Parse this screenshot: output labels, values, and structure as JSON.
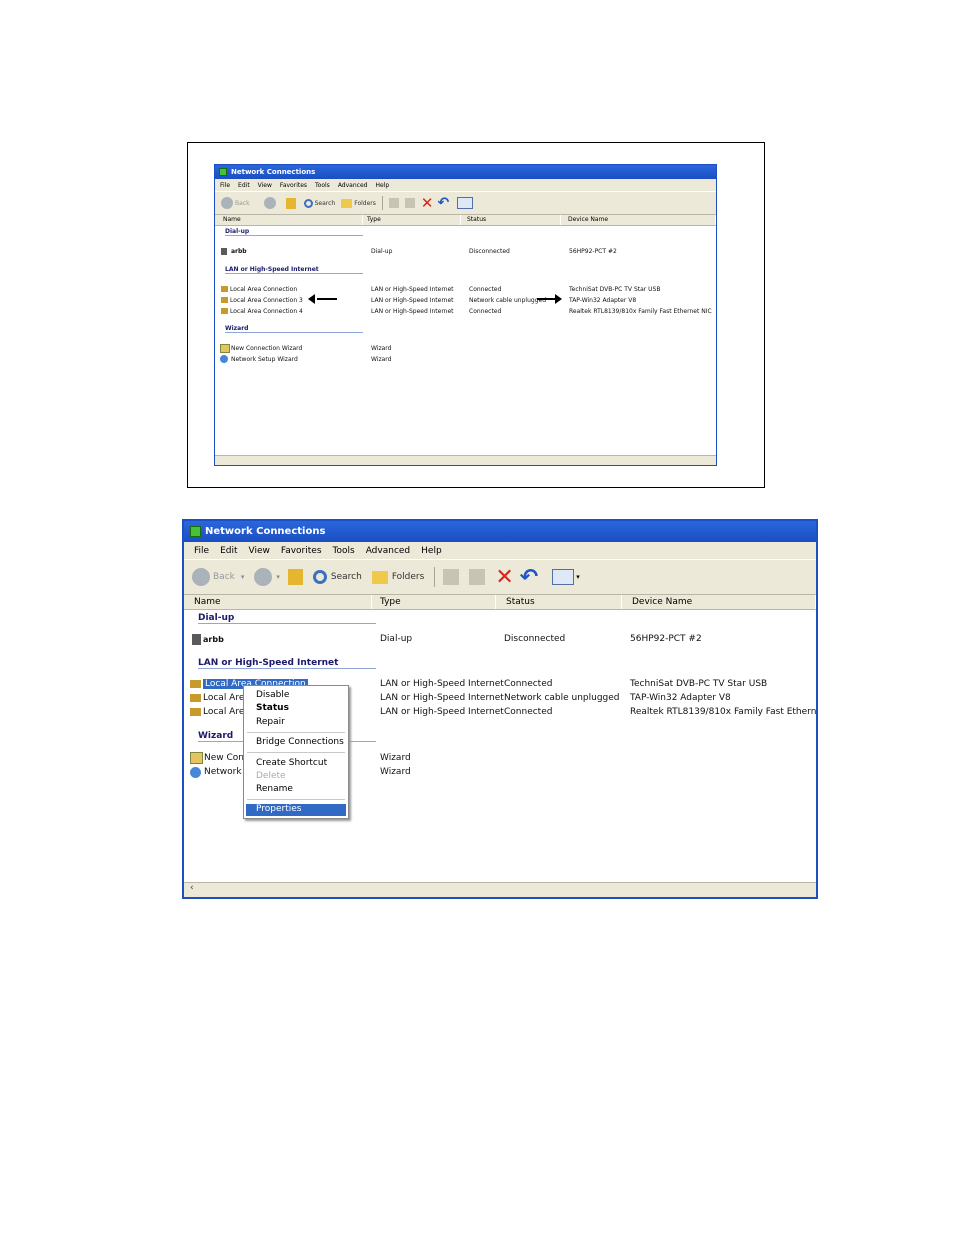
{
  "window": {
    "title": "Network Connections",
    "menu": [
      "File",
      "Edit",
      "View",
      "Favorites",
      "Tools",
      "Advanced",
      "Help"
    ],
    "toolbar": {
      "back": "Back",
      "search": "Search",
      "folders": "Folders"
    },
    "columns": {
      "name": "Name",
      "type": "Type",
      "status": "Status",
      "device": "Device Name"
    },
    "groups": {
      "dialup": "Dial-up",
      "lan": "LAN or High-Speed Internet",
      "wizard": "Wizard"
    },
    "dialup_row": {
      "name": "arbb",
      "type": "Dial-up",
      "status": "Disconnected",
      "device": "56HP92-PCT #2"
    },
    "lan_rows": [
      {
        "name": "Local Area Connection",
        "type": "LAN or High-Speed Internet",
        "status": "Connected",
        "device": "TechniSat DVB-PC TV Star USB"
      },
      {
        "name": "Local Area Connection 3",
        "type": "LAN or High-Speed Internet",
        "status": "Network cable unplugged",
        "device": "TAP-Win32 Adapter V8"
      },
      {
        "name": "Local Area Connection 4",
        "type": "LAN or High-Speed Internet",
        "status": "Connected",
        "device": "Realtek RTL8139/810x Family Fast Ethernet NIC"
      }
    ],
    "wizard_rows": [
      {
        "name": "New Connection Wizard",
        "type": "Wizard"
      },
      {
        "name": "Network Setup Wizard",
        "type": "Wizard"
      }
    ]
  },
  "bottom_window": {
    "truncated_names": [
      "Local Area Connection",
      "Local Area",
      "Local Area"
    ],
    "wizard_truncated": [
      "New Conn",
      "Network S"
    ]
  },
  "context_menu": {
    "items": [
      "Disable",
      "Status",
      "Repair",
      "Bridge Connections",
      "Create Shortcut",
      "Delete",
      "Rename",
      "Properties"
    ],
    "selected": "Properties",
    "disabled": "Delete",
    "bold": "Status"
  },
  "colors": {
    "title_blue": "#1a4fc2",
    "selection_blue": "#316ac5",
    "chrome_beige": "#ece9d8"
  }
}
